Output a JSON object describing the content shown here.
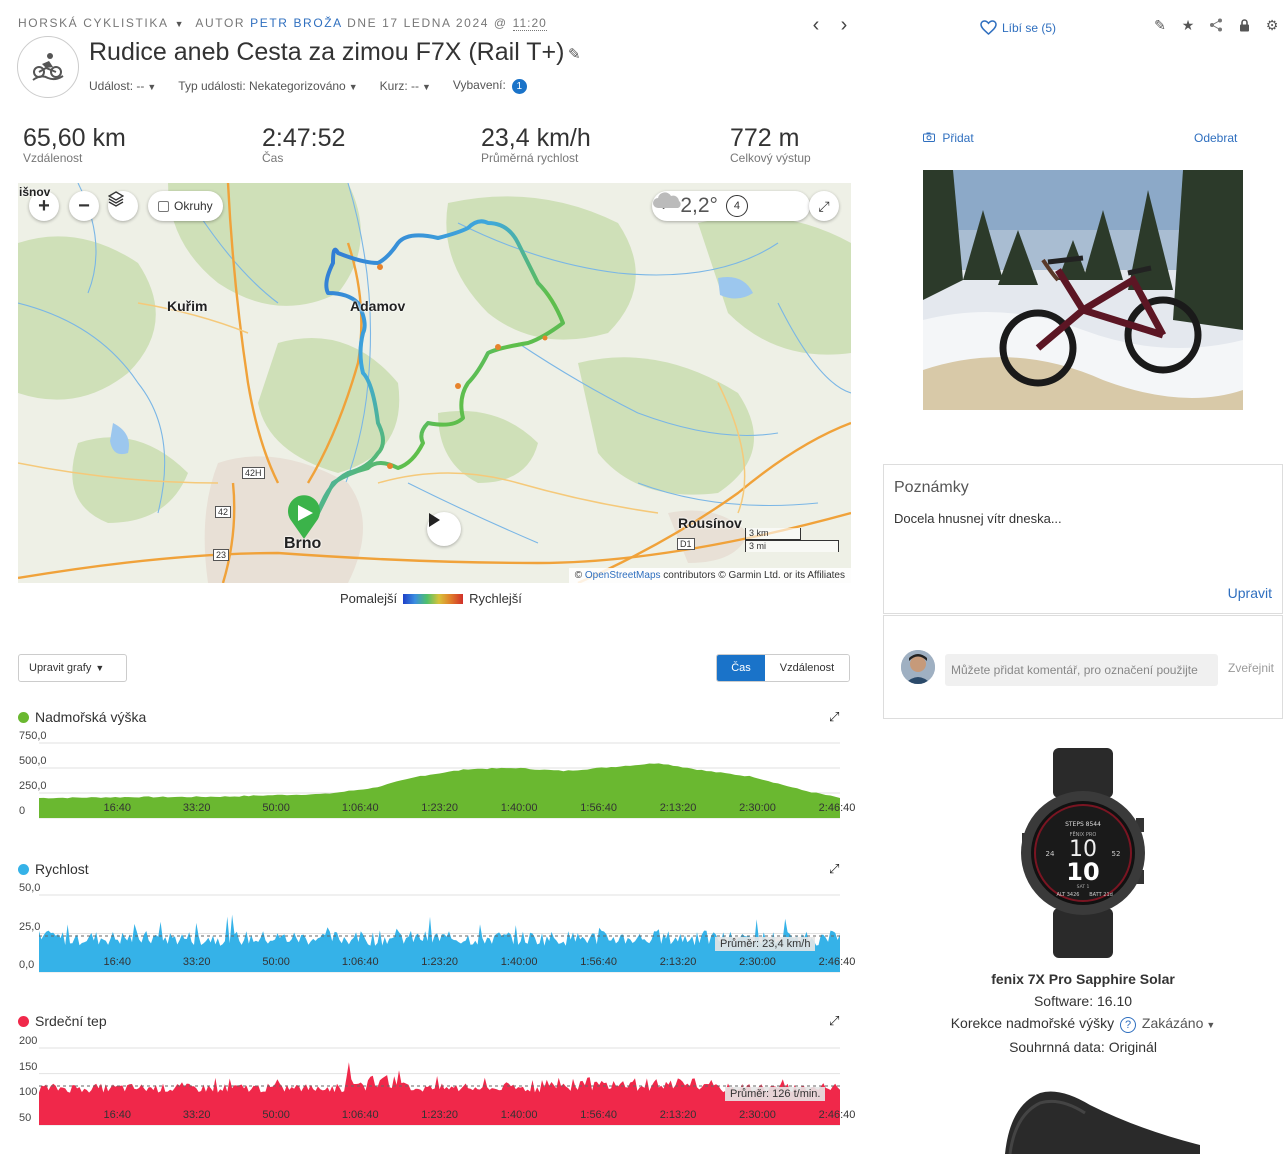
{
  "header": {
    "activity_type": "HORSKÁ CYKLISTIKA",
    "author_prefix": "AUTOR",
    "author_name": "PETR BROŽA",
    "date_prefix": "DNE 17 LEDNA 2024 @",
    "time": "11:20",
    "title": "Rudice aneb Cesta za zimou F7X (Rail T+)",
    "event_label": "Událost: --",
    "event_type_label": "Typ události: Nekategorizováno",
    "course_label": "Kurz: --",
    "gear_label": "Vybavení:",
    "gear_count": "1",
    "like_label": "Líbí se (5)"
  },
  "stats": [
    {
      "value": "65,60 km",
      "label": "Vzdálenost"
    },
    {
      "value": "2:47:52",
      "label": "Čas"
    },
    {
      "value": "23,4 km/h",
      "label": "Průměrná rychlost"
    },
    {
      "value": "772 m",
      "label": "Celkový výstup"
    }
  ],
  "map": {
    "laps_label": "Okruhy",
    "temperature": "-2,2°",
    "wind": "4",
    "places": {
      "kurim": "Kuřim",
      "adamov": "Adamov",
      "brno": "Brno",
      "rousinov": "Rousínov",
      "cut_top": "išnov"
    },
    "roads": {
      "r42h": "42H",
      "r42": "42",
      "r23": "23",
      "d1": "D1"
    },
    "scale_km": "3 km",
    "scale_mi": "3 mi",
    "attribution_prefix": "©",
    "attribution_link": "OpenStreetMaps",
    "attribution_rest": "contributors © Garmin Ltd. or its Affiliates",
    "slower": "Pomalejší",
    "faster": "Rychlejší"
  },
  "chart_controls": {
    "edit_label": "Upravit grafy",
    "time_label": "Čas",
    "distance_label": "Vzdálenost"
  },
  "chart_data": [
    {
      "type": "area",
      "title": "Nadmořská výška",
      "color": "#6ab830",
      "yticks": [
        "750,0",
        "500,0",
        "250,0",
        "0"
      ],
      "ylim": [
        0,
        750
      ],
      "xticks": [
        "16:40",
        "33:20",
        "50:00",
        "1:06:40",
        "1:23:20",
        "1:40:00",
        "1:56:40",
        "2:13:20",
        "2:30:00",
        "2:46:40"
      ],
      "x_minutes": [
        0,
        10,
        20,
        30,
        40,
        50,
        60,
        70,
        80,
        90,
        100,
        110,
        120,
        130,
        140,
        150,
        160,
        168
      ],
      "values": [
        200,
        205,
        210,
        210,
        215,
        230,
        240,
        300,
        420,
        490,
        500,
        470,
        510,
        550,
        470,
        410,
        280,
        200
      ]
    },
    {
      "type": "area",
      "title": "Rychlost",
      "color": "#35b2e8",
      "yticks": [
        "50,0",
        "25,0",
        "0,0"
      ],
      "ylim": [
        0,
        50
      ],
      "xticks": [
        "16:40",
        "33:20",
        "50:00",
        "1:06:40",
        "1:23:20",
        "1:40:00",
        "1:56:40",
        "2:13:20",
        "2:30:00",
        "2:46:40"
      ],
      "average_label": "Průměr: 23,4 km/h",
      "average": 23.4
    },
    {
      "type": "area",
      "title": "Srdeční tep",
      "color": "#f0284a",
      "yticks": [
        "200",
        "150",
        "100",
        "50"
      ],
      "ylim": [
        50,
        200
      ],
      "xticks": [
        "16:40",
        "33:20",
        "50:00",
        "1:06:40",
        "1:23:20",
        "1:40:00",
        "1:56:40",
        "2:13:20",
        "2:30:00",
        "2:46:40"
      ],
      "average_label": "Průměr: 126 t/min.",
      "average": 126
    }
  ],
  "sidebar": {
    "add_label": "Přidat",
    "remove_label": "Odebrat",
    "notes_title": "Poznámky",
    "notes_text": "Docela hnusnej vítr dneska...",
    "notes_edit": "Upravit",
    "comment_placeholder": "Můžete přidat komentář, pro označení použijte",
    "comment_publish": "Zveřejnit",
    "device_name": "fenix 7X Pro Sapphire Solar",
    "software": "Software: 16.10",
    "elev_corr_label": "Korekce nadmořské výšky",
    "elev_corr_value": "Zakázáno",
    "summary_data": "Souhrnná data: Originál",
    "watch_face": {
      "steps": "STEPS 8544",
      "hr": "H 73",
      "brand": "FĒNIX PRO",
      "hour": "10",
      "minute": "10",
      "date": "SAT 1",
      "alt": "ALT 3426",
      "batt": "BATT 21d",
      "left": "24",
      "right": "52"
    }
  }
}
